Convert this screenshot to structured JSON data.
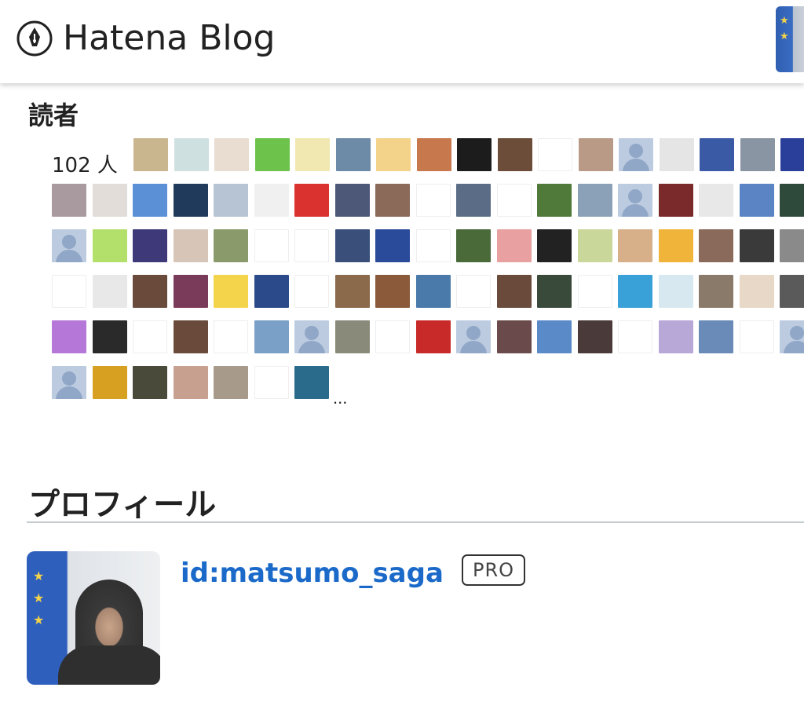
{
  "header": {
    "logo_text": "Hatena Blog",
    "logo_icon": "hatena-pen-icon",
    "avatar": "user-avatar-icon"
  },
  "readers": {
    "title": "読者",
    "count": "102 人",
    "more": "...",
    "avatar_colors": [
      [
        "#c9b58e",
        "#cfe0e0",
        "#e8ddd0",
        "#6cc24a",
        "#f1e7b0",
        "#6d8aa6",
        "#f3d28a",
        "#c7784d",
        "#1c1c1c",
        "#6b4d3a",
        "#ffffff",
        "#b89a86",
        "default",
        "#e5e5e5",
        "#3a5aa6",
        "#8a95a3",
        "#2a3f9a"
      ],
      [
        "#a99aa0",
        "#e2ddd8",
        "#5b8fd6",
        "#1f3a5a",
        "#b6c4d4",
        "#f0f0f0",
        "#d9322f",
        "#4d5878",
        "#8b6a5a",
        "#ffffff",
        "#5b6d86",
        "#ffffff",
        "#4f7a3a",
        "#8ba1b8",
        "default",
        "#7a2a2a",
        "#e8e8e8",
        "#5b84c4",
        "#2e4a3a"
      ],
      [
        "default",
        "#b3e06a",
        "#3e3a7a",
        "#d7c5b8",
        "#8a9a6a",
        "#ffffff",
        "#ffffff",
        "#3a4f7a",
        "#2a4a9a",
        "#ffffff",
        "#4a6a3a",
        "#e8a0a0",
        "#222222",
        "#c9d79a",
        "#d7b08a",
        "#f1b43a",
        "#8a6a5a",
        "#3a3a3a",
        "#8a8a8a"
      ],
      [
        "#ffffff",
        "#e8e8e8",
        "#6a4a3a",
        "#7a3a5a",
        "#f4d44a",
        "#2a4a8a",
        "#ffffff",
        "#8a6a4a",
        "#8a5a3a",
        "#4a7aaa",
        "#ffffff",
        "#6a4a3a",
        "#3a4a3a",
        "#ffffff",
        "#3aa0d8",
        "#d8e8f0",
        "#8a7a6a",
        "#e8d8c8",
        "#5a5a5a"
      ],
      [
        "#b678d8",
        "#2a2a2a",
        "#ffffff",
        "#6a4a3a",
        "#ffffff",
        "#7aa0c8",
        "default",
        "#8a8a7a",
        "#ffffff",
        "#c82a2a",
        "default",
        "#6a4a4a",
        "#5a8ac8",
        "#4a3a3a",
        "#ffffff",
        "#b8a8d8",
        "#6a8ab8",
        "#ffffff",
        "default"
      ],
      [
        "default",
        "#d8a020",
        "#4a4a3a",
        "#c8a090",
        "#a89a8a",
        "#ffffff",
        "#2a6a8a"
      ]
    ]
  },
  "profile": {
    "title": "プロフィール",
    "id": "id:matsumo_saga",
    "badge": "PRO",
    "photo": "profile-photo"
  }
}
